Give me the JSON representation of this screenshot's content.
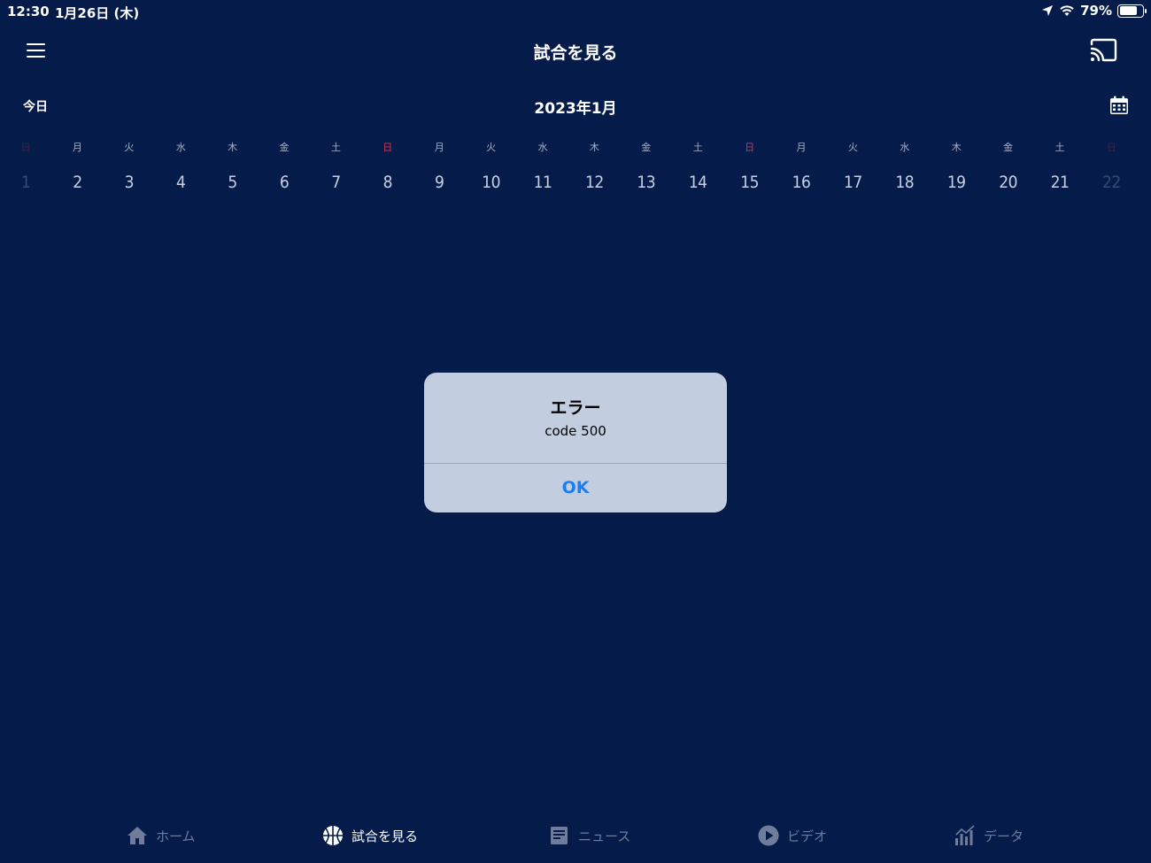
{
  "status_bar": {
    "time": "12:30",
    "date": "1月26日 (木)",
    "battery_percent": "79%",
    "battery_level": 0.79,
    "icons": [
      "location-arrow-icon",
      "wifi-icon",
      "battery-icon"
    ]
  },
  "header": {
    "title": "試合を見る",
    "menu_icon": "hamburger-menu-icon",
    "cast_icon": "cast-icon"
  },
  "calendar": {
    "today_label": "今日",
    "month_label": "2023年1月",
    "calendar_icon": "calendar-icon",
    "days": [
      {
        "weekday": "日",
        "day": "1",
        "sunday": true,
        "faded": true
      },
      {
        "weekday": "月",
        "day": "2"
      },
      {
        "weekday": "火",
        "day": "3"
      },
      {
        "weekday": "水",
        "day": "4"
      },
      {
        "weekday": "木",
        "day": "5"
      },
      {
        "weekday": "金",
        "day": "6"
      },
      {
        "weekday": "土",
        "day": "7"
      },
      {
        "weekday": "日",
        "day": "8",
        "sunday": true
      },
      {
        "weekday": "月",
        "day": "9"
      },
      {
        "weekday": "火",
        "day": "10"
      },
      {
        "weekday": "水",
        "day": "11"
      },
      {
        "weekday": "木",
        "day": "12"
      },
      {
        "weekday": "金",
        "day": "13"
      },
      {
        "weekday": "土",
        "day": "14"
      },
      {
        "weekday": "日",
        "day": "15",
        "sunday": true
      },
      {
        "weekday": "月",
        "day": "16"
      },
      {
        "weekday": "火",
        "day": "17"
      },
      {
        "weekday": "水",
        "day": "18"
      },
      {
        "weekday": "木",
        "day": "19"
      },
      {
        "weekday": "金",
        "day": "20"
      },
      {
        "weekday": "土",
        "day": "21"
      },
      {
        "weekday": "日",
        "day": "22",
        "sunday": true,
        "faded": true
      }
    ]
  },
  "alert": {
    "title": "エラー",
    "message": "code 500",
    "ok_label": "OK"
  },
  "tab_bar": {
    "tabs": [
      {
        "label": "ホーム",
        "icon": "home-icon",
        "active": false
      },
      {
        "label": "試合を見る",
        "icon": "basketball-icon",
        "active": true
      },
      {
        "label": "ニュース",
        "icon": "news-icon",
        "active": false
      },
      {
        "label": "ビデオ",
        "icon": "play-circle-icon",
        "active": false
      },
      {
        "label": "データ",
        "icon": "chart-icon",
        "active": false
      }
    ]
  },
  "colors": {
    "background": "#051c4b",
    "sunday": "#d8344c",
    "alert_background": "#c3cde0",
    "alert_button": "#1a7ef2",
    "tab_inactive": "#6f7c9b"
  }
}
